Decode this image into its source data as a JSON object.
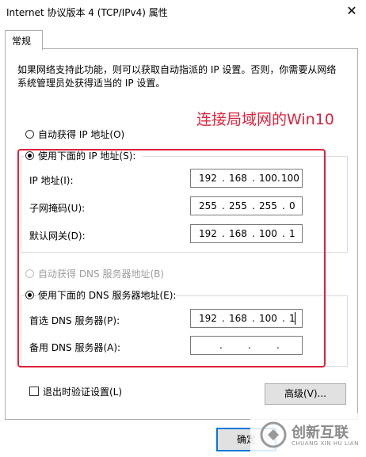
{
  "window": {
    "title": "Internet 协议版本 4 (TCP/IPv4) 属性",
    "close_glyph": "✕"
  },
  "tabs": [
    {
      "label": "常规"
    }
  ],
  "description": "如果网络支持此功能，则可以获取自动指派的 IP 设置。否则，你需要从网络系统管理员处获得适当的 IP 设置。",
  "annotation": "连接局域网的Win10",
  "ip_section": {
    "auto_label": "自动获得 IP 地址(O)",
    "manual_label": "使用下面的 IP 地址(S):",
    "selected": "manual",
    "fields": [
      {
        "label": "IP 地址(I):",
        "octets": [
          "192",
          "168",
          "100",
          "100"
        ]
      },
      {
        "label": "子网掩码(U):",
        "octets": [
          "255",
          "255",
          "255",
          "0"
        ]
      },
      {
        "label": "默认网关(D):",
        "octets": [
          "192",
          "168",
          "100",
          "1"
        ]
      }
    ]
  },
  "dns_section": {
    "auto_label": "自动获得 DNS 服务器地址(B)",
    "manual_label": "使用下面的 DNS 服务器地址(E):",
    "selected": "manual",
    "fields": [
      {
        "label": "首选 DNS 服务器(P):",
        "octets": [
          "192",
          "168",
          "100",
          "1"
        ]
      },
      {
        "label": "备用 DNS 服务器(A):",
        "octets": [
          "",
          "",
          "",
          ""
        ]
      }
    ]
  },
  "validate_on_exit": {
    "label": "退出时验证设置(L)",
    "checked": false
  },
  "buttons": {
    "advanced": "高级(V)...",
    "ok": "确定"
  },
  "watermark": {
    "brand": "创新互联",
    "sub": "CHUANG XIN HU LIAN"
  },
  "colors": {
    "annotation": "#e0223b",
    "accent": "#0078d7"
  }
}
